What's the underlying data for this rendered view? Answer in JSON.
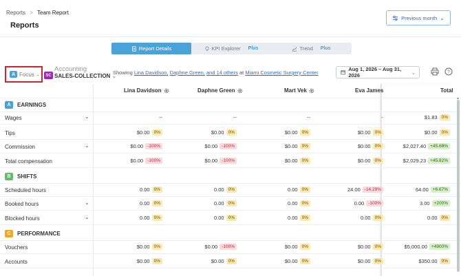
{
  "breadcrumb": {
    "parent": "Reports",
    "separator": ">",
    "current": "Team Report"
  },
  "page_title": "Reports",
  "prev_month_label": "Previous month",
  "tabs": [
    {
      "label": "Report Details",
      "active": true,
      "plus": ""
    },
    {
      "label": "KPI Explorer",
      "active": false,
      "plus": "Plus"
    },
    {
      "label": "Trend",
      "active": false,
      "plus": "Plus"
    }
  ],
  "filter": {
    "focus_letter": "A",
    "focus_label": "Focus",
    "group_chip": "SC",
    "group_category": "Accounting",
    "group_name": "SALES-COLLECTION",
    "showing_prefix": "Showing",
    "staff_1": "Lina Davidson,",
    "staff_2": "Daphne Green,",
    "others": "and 14 others",
    "at_label": "at",
    "location": "Miami Cosmetic Surgery Center",
    "date_range": "Aug 1, 2026 – Aug 31, 2026"
  },
  "columns": [
    "Lina Davidson",
    "Daphne Green",
    "Mart Vek",
    "Eva James",
    "Total"
  ],
  "sections": [
    {
      "letter": "A",
      "name": "EARNINGS",
      "color": "#4aa3d8",
      "rows": [
        {
          "label": "Wages",
          "expandable": true,
          "cells": [
            [
              "--",
              ""
            ],
            [
              "--",
              ""
            ],
            [
              "--",
              ""
            ],
            [
              "-",
              ""
            ]
          ],
          "total": [
            "$1.83",
            "0%",
            "y"
          ]
        },
        {
          "label": "Tips",
          "expandable": false,
          "cells": [
            [
              "$0.00",
              "0%",
              "y"
            ],
            [
              "$0.00",
              "0%",
              "y"
            ],
            [
              "$0.00",
              "0%",
              "y"
            ],
            [
              "$0.00",
              "0%",
              "y"
            ]
          ],
          "total": [
            "$0.00",
            "0%",
            "y"
          ]
        },
        {
          "label": "Commission",
          "expandable": true,
          "cells": [
            [
              "$0.00",
              "-100%",
              "r"
            ],
            [
              "$0.00",
              "-100%",
              "r"
            ],
            [
              "$0.00",
              "0%",
              "y"
            ],
            [
              "$0.00",
              "0%",
              "y"
            ]
          ],
          "total": [
            "$2,027.40",
            "+45.68%",
            "g"
          ]
        },
        {
          "label": "Total compensation",
          "expandable": false,
          "cells": [
            [
              "$0.00",
              "-100%",
              "r"
            ],
            [
              "$0.00",
              "-100%",
              "r"
            ],
            [
              "$0.00",
              "0%",
              "y"
            ],
            [
              "$0.00",
              "0%",
              "y"
            ]
          ],
          "total": [
            "$2,029.23",
            "+45.82%",
            "g"
          ]
        }
      ]
    },
    {
      "letter": "B",
      "name": "SHIFTS",
      "color": "#66bb6a",
      "rows": [
        {
          "label": "Scheduled hours",
          "expandable": false,
          "cells": [
            [
              "0.00",
              "0%",
              "y"
            ],
            [
              "0.00",
              "0%",
              "y"
            ],
            [
              "0.00",
              "0%",
              "y"
            ],
            [
              "24.00",
              "-14.29%",
              "r"
            ]
          ],
          "total": [
            "64.00",
            "+6.67%",
            "g"
          ]
        },
        {
          "label": "Booked hours",
          "expandable": true,
          "cells": [
            [
              "0.00",
              "0%",
              "y"
            ],
            [
              "0.00",
              "0%",
              "y"
            ],
            [
              "0.00",
              "0%",
              "y"
            ],
            [
              "0.00",
              "-100%",
              "r"
            ]
          ],
          "total": [
            "3.00",
            "+200%",
            "g"
          ]
        },
        {
          "label": "Blocked hours",
          "expandable": true,
          "cells": [
            [
              "0.00",
              "0%",
              "y"
            ],
            [
              "0.00",
              "0%",
              "y"
            ],
            [
              "0.00",
              "0%",
              "y"
            ],
            [
              "0.00",
              "0%",
              "y"
            ]
          ],
          "total": [
            "0.00",
            "0%",
            "y"
          ]
        }
      ]
    },
    {
      "letter": "C",
      "name": "PERFORMANCE",
      "color": "#f5a623",
      "rows": [
        {
          "label": "Vouchers",
          "expandable": false,
          "cells": [
            [
              "$0.00",
              "0%",
              "y"
            ],
            [
              "$0.00",
              "-100%",
              "r"
            ],
            [
              "$0.00",
              "0%",
              "y"
            ],
            [
              "$0.00",
              "0%",
              "y"
            ]
          ],
          "total": [
            "$5,000.00",
            "+4900%",
            "g"
          ]
        },
        {
          "label": "Accounts",
          "expandable": false,
          "cells": [
            [
              "$0.00",
              "0%",
              "y"
            ],
            [
              "$0.00",
              "0%",
              "y"
            ],
            [
              "$0.00",
              "0%",
              "y"
            ],
            [
              "$0.00",
              "0%",
              "y"
            ]
          ],
          "total": [
            "$350.00",
            "0%",
            "y"
          ]
        }
      ]
    }
  ],
  "colors": {
    "accent": "#4aa3d8",
    "highlight_border": "#d2232a",
    "link": "#2a6fc9"
  }
}
